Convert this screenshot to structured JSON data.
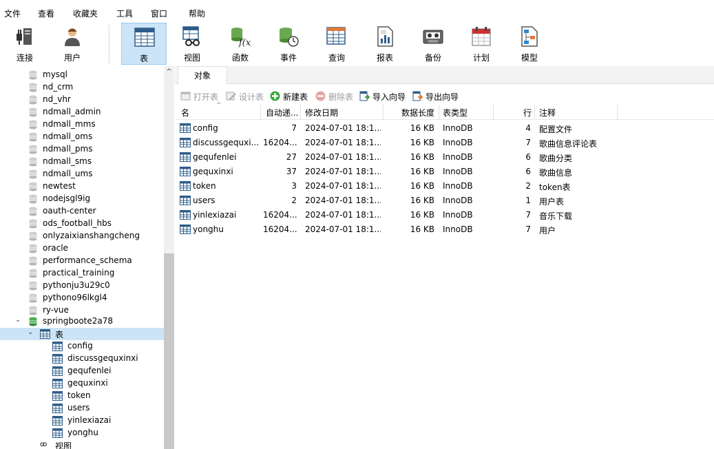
{
  "menu": [
    "文件",
    "查看",
    "收藏夹",
    "工具",
    "窗口",
    "帮助"
  ],
  "toolbar": [
    {
      "label": "连接",
      "icon": "connection-icon"
    },
    {
      "label": "用户",
      "icon": "user-icon"
    },
    {
      "label": "表",
      "icon": "table-icon",
      "active": true
    },
    {
      "label": "视图",
      "icon": "view-icon"
    },
    {
      "label": "函数",
      "icon": "function-icon"
    },
    {
      "label": "事件",
      "icon": "event-icon"
    },
    {
      "label": "查询",
      "icon": "query-icon"
    },
    {
      "label": "报表",
      "icon": "report-icon"
    },
    {
      "label": "备份",
      "icon": "backup-icon"
    },
    {
      "label": "计划",
      "icon": "schedule-icon"
    },
    {
      "label": "模型",
      "icon": "model-icon"
    }
  ],
  "tree": {
    "databases": [
      "mysql",
      "nd_crm",
      "nd_vhr",
      "ndmall_admin",
      "ndmall_mms",
      "ndmall_oms",
      "ndmall_pms",
      "ndmall_sms",
      "ndmall_ums",
      "newtest",
      "nodejsgl9ig",
      "oauth-center",
      "ods_football_hbs",
      "onlyzaixianshangcheng",
      "oracle",
      "performance_schema",
      "practical_training",
      "pythonju3u29c0",
      "pythono96lkgl4",
      "ry-vue"
    ],
    "open_db": "springboote2a78",
    "tables_node": "表",
    "tables": [
      "config",
      "discussgequxinxi",
      "gequfenlei",
      "gequxinxi",
      "token",
      "users",
      "yinlexiazai",
      "yonghu"
    ],
    "views_node": "视图"
  },
  "tab": {
    "label": "对象"
  },
  "objbar": {
    "open": "打开表",
    "design": "设计表",
    "new": "新建表",
    "delete": "删除表",
    "import": "导入向导",
    "export": "导出向导"
  },
  "columns": {
    "name": "名",
    "autoinc": "自动递...",
    "modified": "修改日期",
    "datalen": "数据长度",
    "type": "表类型",
    "rows": "行",
    "comment": "注释"
  },
  "rows": [
    {
      "name": "config",
      "autoinc": "7",
      "modified": "2024-07-01 18:1...",
      "datalen": "16 KB",
      "type": "InnoDB",
      "rows": "4",
      "comment": "配置文件"
    },
    {
      "name": "discussgequxi...",
      "autoinc": "16204...",
      "modified": "2024-07-01 18:1...",
      "datalen": "16 KB",
      "type": "InnoDB",
      "rows": "7",
      "comment": "歌曲信息评论表"
    },
    {
      "name": "gequfenlei",
      "autoinc": "27",
      "modified": "2024-07-01 18:1...",
      "datalen": "16 KB",
      "type": "InnoDB",
      "rows": "6",
      "comment": "歌曲分类"
    },
    {
      "name": "gequxinxi",
      "autoinc": "37",
      "modified": "2024-07-01 18:1...",
      "datalen": "16 KB",
      "type": "InnoDB",
      "rows": "6",
      "comment": "歌曲信息"
    },
    {
      "name": "token",
      "autoinc": "3",
      "modified": "2024-07-01 18:1...",
      "datalen": "16 KB",
      "type": "InnoDB",
      "rows": "2",
      "comment": "token表"
    },
    {
      "name": "users",
      "autoinc": "2",
      "modified": "2024-07-01 18:1...",
      "datalen": "16 KB",
      "type": "InnoDB",
      "rows": "1",
      "comment": "用户表"
    },
    {
      "name": "yinlexiazai",
      "autoinc": "16204...",
      "modified": "2024-07-01 18:1...",
      "datalen": "16 KB",
      "type": "InnoDB",
      "rows": "7",
      "comment": "音乐下载"
    },
    {
      "name": "yonghu",
      "autoinc": "16204...",
      "modified": "2024-07-01 18:1...",
      "datalen": "16 KB",
      "type": "InnoDB",
      "rows": "7",
      "comment": "用户"
    }
  ]
}
